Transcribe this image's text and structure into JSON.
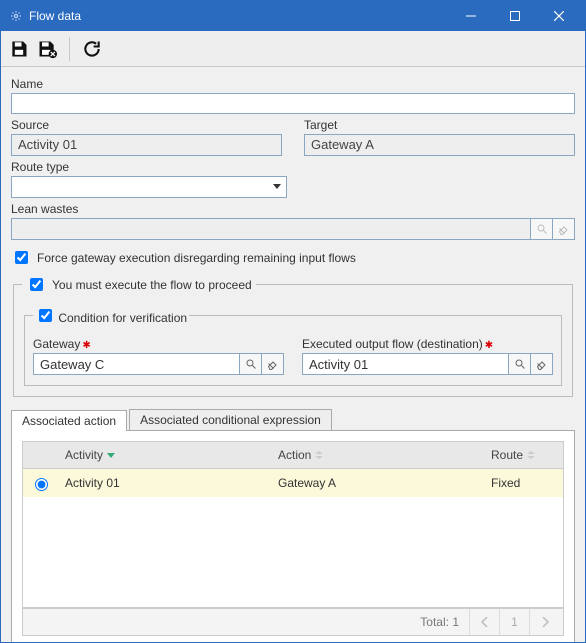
{
  "window": {
    "title": "Flow data"
  },
  "toolbar": {
    "save_tooltip": "Save",
    "save_exit_tooltip": "Save and exit",
    "refresh_tooltip": "Refresh"
  },
  "labels": {
    "name": "Name",
    "source": "Source",
    "target": "Target",
    "route_type": "Route type",
    "lean_wastes": "Lean wastes",
    "force_gateway": "Force gateway execution disregarding remaining input flows",
    "must_execute": "You must execute the flow to proceed",
    "condition": "Condition for verification",
    "gateway": "Gateway",
    "exec_output": "Executed output flow (destination)"
  },
  "fields": {
    "name": "",
    "source": "Activity 01",
    "target": "Gateway A",
    "route_type": "",
    "lean_wastes": "",
    "force_gateway_checked": true,
    "must_execute_checked": true,
    "condition_checked": true,
    "gateway": "Gateway C",
    "exec_output": "Activity 01"
  },
  "tabs": {
    "associated_action": "Associated action",
    "associated_cond_expr": "Associated conditional expression",
    "active": "associated_action"
  },
  "table": {
    "headers": {
      "activity": "Activity",
      "action": "Action",
      "route": "Route"
    },
    "rows": [
      {
        "activity": "Activity 01",
        "action": "Gateway A",
        "route": "Fixed",
        "selected": true
      }
    ],
    "total_label": "Total:",
    "total": 1,
    "page": 1
  }
}
